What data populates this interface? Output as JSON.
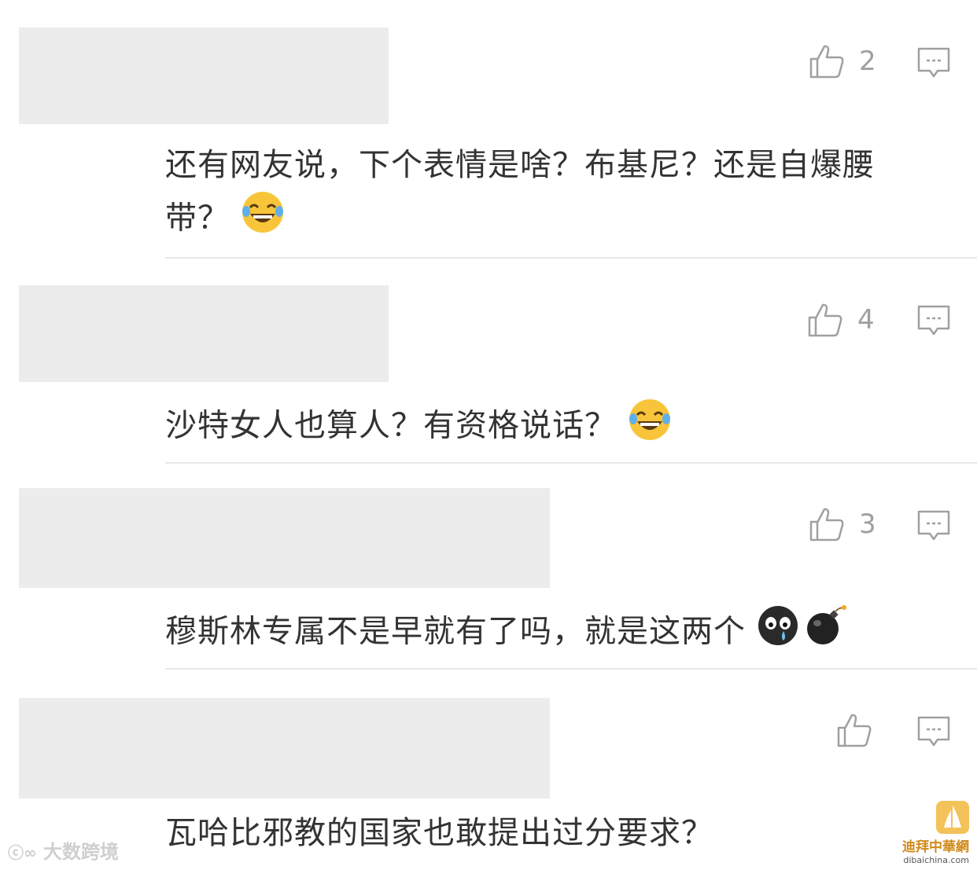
{
  "comments": [
    {
      "likes": "2",
      "text_line1": "还有网友说，下个表情是啥？布基尼？还是自爆腰",
      "text_line2": "带？",
      "emojis": [
        "laugh-cry-emoji"
      ]
    },
    {
      "likes": "4",
      "text": "沙特女人也算人？有资格说话？",
      "emojis": [
        "laugh-cry-emoji"
      ]
    },
    {
      "likes": "3",
      "text": "穆斯林专属不是早就有了吗，就是这两个",
      "emojis": [
        "crying-face-emoji",
        "bomb-emoji"
      ]
    },
    {
      "likes": "",
      "text": "瓦哈比邪教的国家也敢提出过分要求？",
      "emojis": []
    }
  ],
  "watermarks": {
    "left": "大数跨境",
    "right_cn": "迪拜中華網",
    "right_url": "dibaichina.com"
  },
  "colors": {
    "text": "#333333",
    "icon": "#a0a0a0",
    "redaction": "#ececec",
    "divider": "#e7e7e7"
  }
}
